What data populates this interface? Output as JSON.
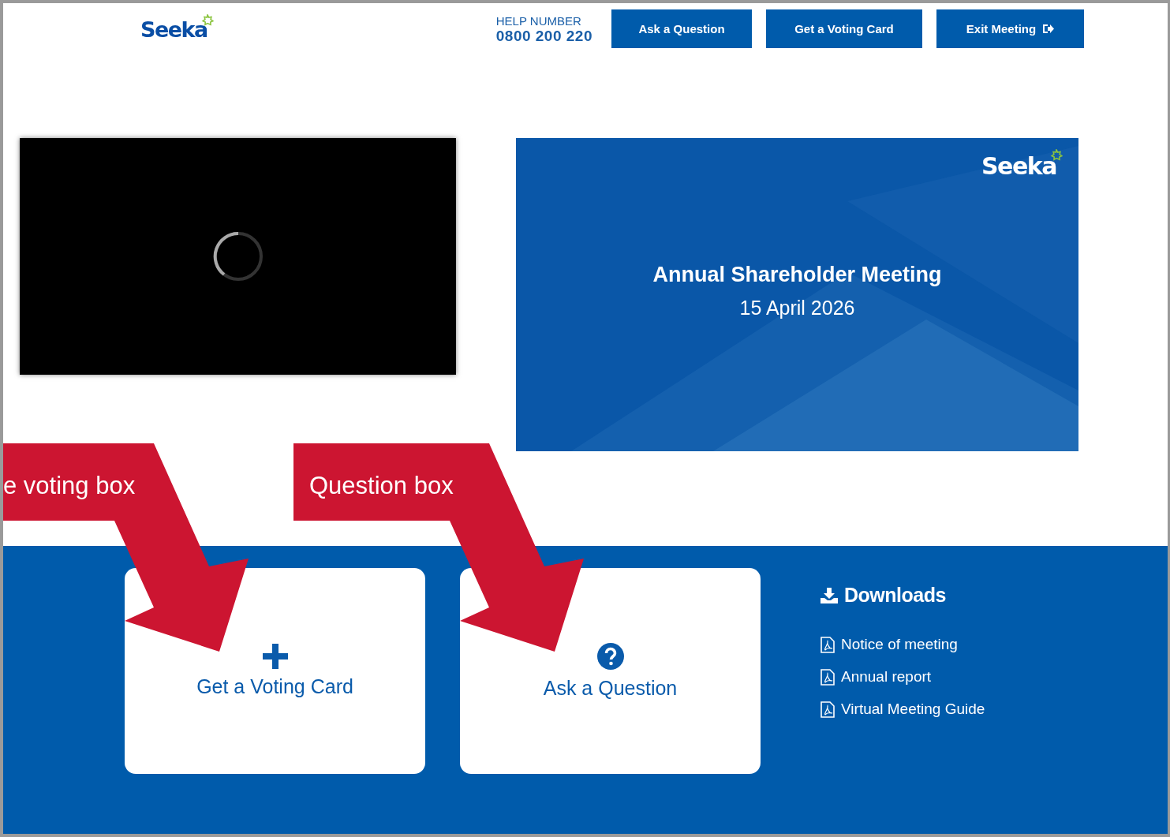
{
  "header": {
    "logo": "Seeka",
    "help_label": "HELP NUMBER",
    "help_number": "0800 200 220",
    "buttons": [
      {
        "kind": "plain",
        "label": "Ask a Question"
      },
      {
        "kind": "plain",
        "label": "Get a Voting Card"
      },
      {
        "kind": "exit",
        "label": "Exit Meeting"
      }
    ]
  },
  "slide": {
    "logo": "Seeka",
    "title": "Annual Shareholder Meeting",
    "date": "15 April 2026"
  },
  "cards": [
    {
      "kind": "plus",
      "label": "Get a Voting Card"
    },
    {
      "kind": "question",
      "label": "Ask a Question"
    }
  ],
  "downloads": {
    "title": "Downloads",
    "items": [
      "Notice of meeting",
      "Annual report",
      "Virtual Meeting Guide"
    ]
  },
  "callouts": [
    "e voting box",
    "Question box"
  ]
}
